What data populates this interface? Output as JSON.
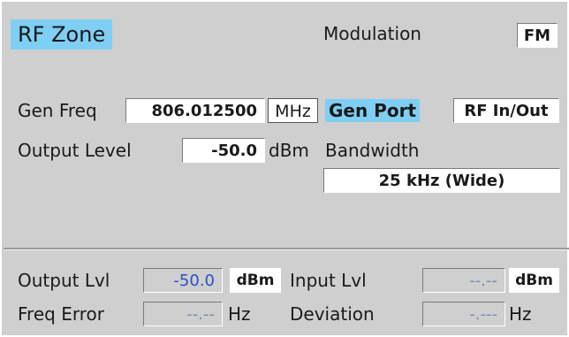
{
  "header": {
    "title": "RF Zone",
    "modulation_label": "Modulation",
    "modulation_value": "FM"
  },
  "generator": {
    "gen_freq_label": "Gen Freq",
    "gen_freq_value": "806.012500",
    "gen_freq_unit": "MHz",
    "gen_port_label": "Gen Port",
    "gen_port_value": "RF In/Out",
    "output_level_label": "Output Level",
    "output_level_value": "-50.0",
    "output_level_unit": "dBm",
    "bandwidth_label": "Bandwidth",
    "bandwidth_value": "25 kHz (Wide)"
  },
  "measurements": {
    "output_lvl_label": "Output Lvl",
    "output_lvl_value": "-50.0",
    "output_lvl_unit": "dBm",
    "input_lvl_label": "Input Lvl",
    "input_lvl_value": "--.--",
    "input_lvl_unit": "dBm",
    "freq_error_label": "Freq Error",
    "freq_error_value": "--.--",
    "freq_error_unit": "Hz",
    "deviation_label": "Deviation",
    "deviation_value": "-.---",
    "deviation_unit": "Hz"
  },
  "colors": {
    "panel_bg": "#cfcfcf",
    "highlight": "#7ecff3",
    "measured_value": "#2a4fc8"
  }
}
